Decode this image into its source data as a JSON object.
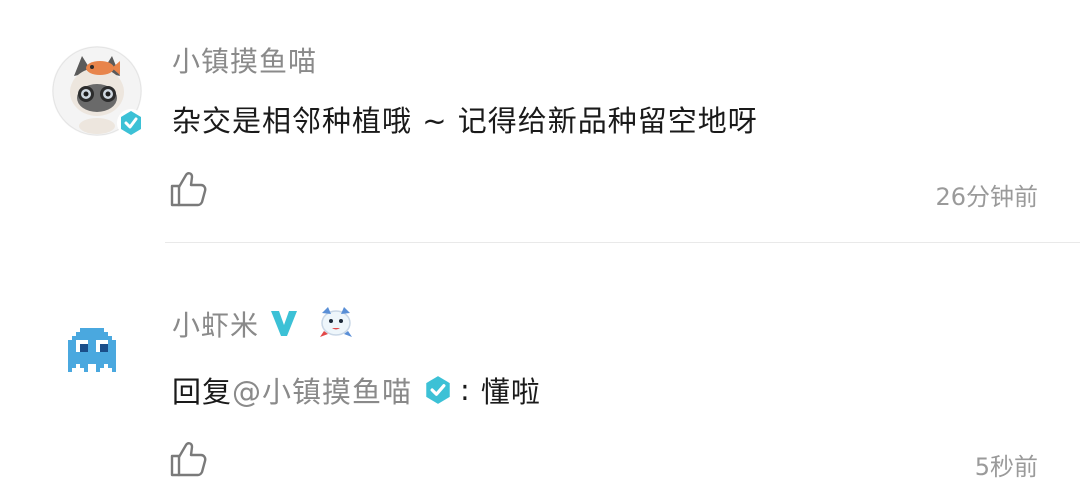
{
  "comments": [
    {
      "username": "小镇摸鱼喵",
      "text": "杂交是相邻种植哦 ~ 记得给新品种留空地呀",
      "timestamp": "26分钟前",
      "avatar_icon": "cat-avatar",
      "verified": true
    },
    {
      "username": "小虾米",
      "reply_prefix": "回复",
      "mention": "@小镇摸鱼喵",
      "separator": ":",
      "text": "懂啦",
      "timestamp": "5秒前",
      "avatar_icon": "pixel-ghost-avatar",
      "badges": [
        "v-badge",
        "medal-icon"
      ]
    }
  ],
  "colors": {
    "verify_badge": "#3cc1d6",
    "v_badge": "#3cc1d6",
    "ghost": "#4aa8df"
  },
  "icons": {
    "like": "thumbs-up-icon"
  }
}
